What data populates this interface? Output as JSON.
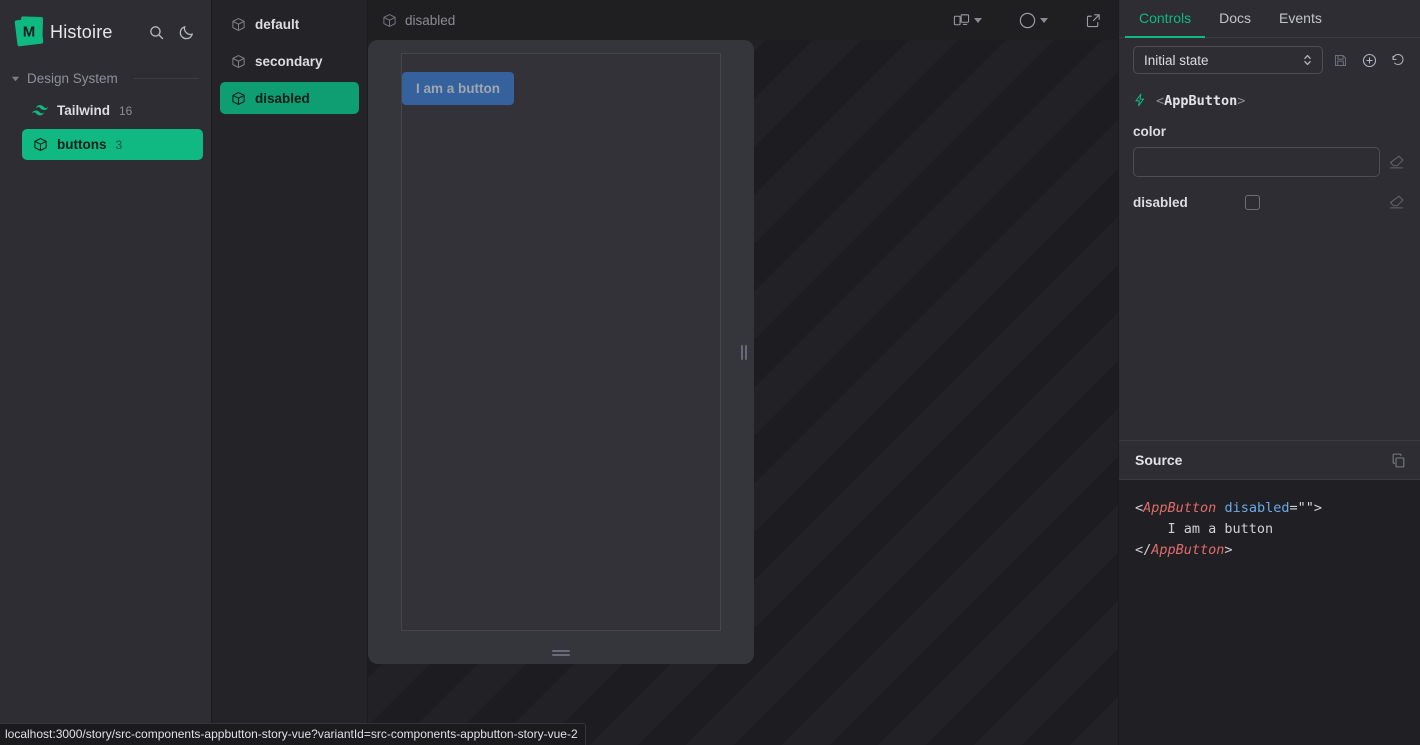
{
  "app": {
    "brand": "Histoire",
    "logo_glyph": "M",
    "accent": "#10b981",
    "search_icon": "search-icon",
    "theme_icon": "moon-icon"
  },
  "sidebar": {
    "group": {
      "label": "Design System",
      "expanded": true
    },
    "items": [
      {
        "label": "Tailwind",
        "count": "16",
        "icon": "tailwind-icon",
        "selected": false
      },
      {
        "label": "buttons",
        "count": "3",
        "icon": "cube-icon",
        "selected": true
      }
    ]
  },
  "variants": {
    "items": [
      {
        "label": "default",
        "icon": "cube-icon",
        "active": false
      },
      {
        "label": "secondary",
        "icon": "cube-icon",
        "active": false
      },
      {
        "label": "disabled",
        "icon": "cube-icon",
        "active": true
      }
    ]
  },
  "breadcrumb": {
    "label": "disabled",
    "icon": "cube-icon"
  },
  "toolbar": {
    "responsive_icon": "responsive-sizes-icon",
    "background_icon": "color-circle-icon",
    "open_new_icon": "open-in-new-icon"
  },
  "preview": {
    "button_label": "I am a button",
    "button_color": "#35629c",
    "button_text_color": "#9fa6af",
    "resize_handle_vertical": "resize-handle-vertical",
    "resize_handle_horizontal": "resize-handle-horizontal"
  },
  "panel": {
    "tabs": [
      {
        "label": "Controls",
        "active": true
      },
      {
        "label": "Docs",
        "active": false
      },
      {
        "label": "Events",
        "active": false
      }
    ],
    "state_select": {
      "value": "Initial state"
    },
    "state_actions": [
      {
        "name": "save-state-icon"
      },
      {
        "name": "add-state-icon"
      },
      {
        "name": "reset-state-icon"
      }
    ],
    "component": {
      "bracket_open": "<",
      "name": "AppButton",
      "bracket_close": ">"
    },
    "controls": [
      {
        "label": "color",
        "type": "text",
        "value": "",
        "reset_icon": "eraser-icon"
      },
      {
        "label": "disabled",
        "type": "checkbox",
        "checked": false,
        "reset_icon": "eraser-icon"
      }
    ]
  },
  "source": {
    "title": "Source",
    "copy_icon": "copy-icon",
    "lines": [
      {
        "tag_open": "<",
        "tag": "AppButton",
        "attr": " disabled",
        "eq": "=",
        "str": "\"\"",
        "gt": ">"
      },
      {
        "text": "    I am a button"
      },
      {
        "close": "</",
        "tag": "AppButton",
        "gt": ">"
      }
    ],
    "line1_open": "<",
    "line1_tag": "AppButton",
    "line1_attr": "disabled",
    "line1_eq": "=",
    "line1_str": "\"\"",
    "line1_gt": ">",
    "line2": "    I am a button",
    "line3_close": "</",
    "line3_tag": "AppButton",
    "line3_gt": ">"
  },
  "statusbar": {
    "url": "localhost:3000/story/src-components-appbutton-story-vue?variantId=src-components-appbutton-story-vue-2"
  }
}
